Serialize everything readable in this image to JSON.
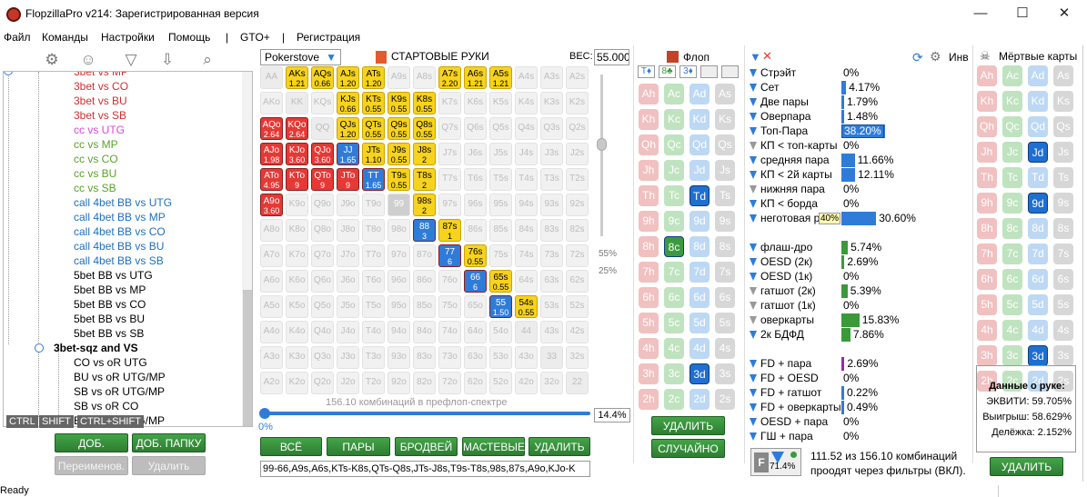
{
  "window": {
    "title": "FlopzillaPro v214: Зарегистрированная версия",
    "minimize": "—",
    "maximize": "☐",
    "close": "✕"
  },
  "menu": [
    "Файл",
    "Команды",
    "Настройки",
    "Помощь",
    "|",
    "GTO+",
    "|",
    "Регистрация"
  ],
  "tree": {
    "items": [
      {
        "text": "3bet vs MP",
        "color": "#d32f2f",
        "indent": 80
      },
      {
        "text": "3bet vs CO",
        "color": "#d32f2f",
        "indent": 80
      },
      {
        "text": "3bet vs BU",
        "color": "#d32f2f",
        "indent": 80
      },
      {
        "text": "3bet vs SB",
        "color": "#d32f2f",
        "indent": 80
      },
      {
        "text": "cc vs UTG",
        "color": "#d946d9",
        "indent": 80
      },
      {
        "text": "cc vs MP",
        "color": "#5aa22a",
        "indent": 80
      },
      {
        "text": "cc vs CO",
        "color": "#5aa22a",
        "indent": 80
      },
      {
        "text": "cc vs BU",
        "color": "#5aa22a",
        "indent": 80
      },
      {
        "text": "cc vs SB",
        "color": "#5aa22a",
        "indent": 80
      },
      {
        "text": "call 4bet BB vs UTG",
        "color": "#1e6fc0",
        "indent": 80
      },
      {
        "text": "call 4bet BB vs MP",
        "color": "#1e6fc0",
        "indent": 80
      },
      {
        "text": "call 4bet BB vs CO",
        "color": "#1e6fc0",
        "indent": 80
      },
      {
        "text": "call 4bet BB vs BU",
        "color": "#1e6fc0",
        "indent": 80
      },
      {
        "text": "call 4bet BB vs SB",
        "color": "#1e6fc0",
        "indent": 80
      },
      {
        "text": "5bet BB vs UTG",
        "color": "#000",
        "indent": 80
      },
      {
        "text": "5bet BB vs MP",
        "color": "#000",
        "indent": 80
      },
      {
        "text": "5bet BB vs CO",
        "color": "#000",
        "indent": 80
      },
      {
        "text": "5bet BB vs BU",
        "color": "#000",
        "indent": 80
      },
      {
        "text": "5bet BB vs SB",
        "color": "#000",
        "indent": 80
      },
      {
        "text": "3bet-sqz and VS",
        "color": "#000",
        "indent": 58,
        "bold": true
      },
      {
        "text": "CO vs oR UTG",
        "color": "#000",
        "indent": 80
      },
      {
        "text": "BU vs oR UTG/MP",
        "color": "#000",
        "indent": 80
      },
      {
        "text": "SB vs oR UTG/MP",
        "color": "#000",
        "indent": 80
      },
      {
        "text": "SB vs oR CO",
        "color": "#000",
        "indent": 80
      },
      {
        "text": "BB vs oR UTG/MP",
        "color": "#000",
        "indent": 80
      }
    ],
    "keys": [
      "CTRL",
      "SHIFT",
      "CTRL+SHIFT"
    ]
  },
  "left_buttons": {
    "add_range": "ДОБ. СПЕКТР",
    "add_folder": "ДОБ. ПАПКУ",
    "rename": "Переименов.",
    "delete": "Удалить"
  },
  "preflop": {
    "source": "Pokerstove",
    "title": "СТАРТОВЫЕ РУКИ",
    "weight_label": "ВЕС:",
    "weight": "55.000",
    "pct55": "55%",
    "pct25": "25%",
    "combos_text": "156.10 комбинаций в префлоп-спектре",
    "slider_pct": "0%",
    "pct_box": "14.4%",
    "range_text": "99-66,A9s,A6s,KTs-K8s,QTs-Q8s,JTs-J8s,T9s-T8s,98s,87s,A9o,KJo-K"
  },
  "grid_buttons": {
    "all": "ВСЁ",
    "pairs": "ПАРЫ",
    "broadway": "БРОДВЕЙ",
    "suited": "МАСТЕВЫЕ",
    "delete": "УДАЛИТЬ"
  },
  "grid_ranks": [
    "A",
    "K",
    "Q",
    "J",
    "T",
    "9",
    "8",
    "7",
    "6",
    "5",
    "4",
    "3",
    "2"
  ],
  "grid_selected": {
    "0,1": [
      "y",
      "1.21"
    ],
    "0,2": [
      "y",
      "0.66"
    ],
    "0,3": [
      "y",
      "1.20"
    ],
    "0,4": [
      "y",
      "1.20"
    ],
    "0,7": [
      "y",
      "2.20"
    ],
    "0,8": [
      "y",
      "1.21"
    ],
    "0,9": [
      "y",
      "1.21"
    ],
    "1,3": [
      "y",
      "0.66"
    ],
    "1,4": [
      "y",
      "0.55"
    ],
    "1,5": [
      "y",
      "0.55"
    ],
    "1,6": [
      "y",
      "0.55"
    ],
    "2,0": [
      "r",
      "2.64"
    ],
    "2,1": [
      "r",
      "2.64"
    ],
    "2,3": [
      "y",
      "1.20"
    ],
    "2,4": [
      "y",
      "0.55"
    ],
    "2,5": [
      "y",
      "0.55"
    ],
    "2,6": [
      "y",
      "0.55"
    ],
    "3,0": [
      "r",
      "1.98"
    ],
    "3,1": [
      "r",
      "3.60"
    ],
    "3,2": [
      "r",
      "3.60"
    ],
    "3,3": [
      "b",
      "1.65"
    ],
    "3,4": [
      "y",
      "1.10"
    ],
    "3,5": [
      "y",
      "0.55"
    ],
    "3,6": [
      "y",
      "2"
    ],
    "4,0": [
      "r",
      "4.95"
    ],
    "4,1": [
      "r",
      "9"
    ],
    "4,2": [
      "r",
      "9"
    ],
    "4,3": [
      "r",
      "9"
    ],
    "4,4": [
      "b",
      "1.65"
    ],
    "4,5": [
      "y",
      "0.55"
    ],
    "4,6": [
      "y",
      "2"
    ],
    "5,0": [
      "r",
      "3.60"
    ],
    "5,6": [
      "y",
      "2"
    ],
    "6,6": [
      "b",
      "3"
    ],
    "6,7": [
      "y",
      "1"
    ],
    "7,7": [
      "b",
      "6"
    ],
    "7,8": [
      "y",
      "0.55"
    ],
    "8,8": [
      "b",
      "6"
    ],
    "8,9": [
      "y",
      "0.55"
    ],
    "9,9": [
      "b",
      "1.50"
    ],
    "9,10": [
      "y",
      "0.55"
    ]
  },
  "flop": {
    "title": "Флоп",
    "slots": [
      "T♦",
      "8♣",
      "3♦",
      "",
      ""
    ],
    "delete": "УДАЛИТЬ",
    "random": "СЛУЧАЙНО"
  },
  "card_ranks": [
    "A",
    "K",
    "Q",
    "J",
    "T",
    "9",
    "8",
    "7",
    "6",
    "5",
    "4",
    "3",
    "2"
  ],
  "flop_selected": {
    "T,♦": "blue",
    "8,♣": "green",
    "3,♦": "blue"
  },
  "filters": [
    {
      "label": "Стрэйт",
      "value": "0%",
      "bar": 0,
      "icon": "b"
    },
    {
      "label": "Сет",
      "value": "4.17%",
      "bar": 4.17,
      "icon": "b"
    },
    {
      "label": "Две пары",
      "value": "1.79%",
      "bar": 1.79,
      "icon": "b"
    },
    {
      "label": "Оверпара",
      "value": "1.48%",
      "bar": 1.48,
      "icon": "b"
    },
    {
      "label": "Топ-Пара",
      "value": "38.20%",
      "bar": 38.2,
      "icon": "b",
      "boxed": true
    },
    {
      "label": "КП < топ-карты",
      "value": "0%",
      "bar": 0,
      "icon": "g"
    },
    {
      "label": "средняя пара",
      "value": "11.66%",
      "bar": 11.66,
      "icon": "b"
    },
    {
      "label": "КП < 2й карты",
      "value": "12.11%",
      "bar": 12.11,
      "icon": "b"
    },
    {
      "label": "нижняя пара",
      "value": "0%",
      "bar": 0,
      "icon": "g"
    },
    {
      "label": "КП < борда",
      "value": "0%",
      "bar": 0,
      "icon": "b"
    },
    {
      "label": "неготовая р",
      "value": "30.60%",
      "bar": 30.6,
      "icon": "b",
      "tag": "40%"
    },
    {
      "label": "",
      "value": "",
      "bar": 0,
      "icon": "none"
    },
    {
      "label": "флаш-дро",
      "value": "5.74%",
      "bar": 5.74,
      "icon": "b",
      "color": "g"
    },
    {
      "label": "OESD (2к)",
      "value": "2.69%",
      "bar": 2.69,
      "icon": "b",
      "color": "g"
    },
    {
      "label": "OESD (1к)",
      "value": "0%",
      "bar": 0,
      "icon": "b",
      "color": "g"
    },
    {
      "label": "гатшот (2к)",
      "value": "5.39%",
      "bar": 5.39,
      "icon": "g",
      "color": "g"
    },
    {
      "label": "гатшот (1к)",
      "value": "0%",
      "bar": 0,
      "icon": "g",
      "color": "g"
    },
    {
      "label": "оверкарты",
      "value": "15.83%",
      "bar": 15.83,
      "icon": "g",
      "color": "g"
    },
    {
      "label": "2к БДФД",
      "value": "7.86%",
      "bar": 7.86,
      "icon": "b",
      "color": "g"
    },
    {
      "label": "",
      "value": "",
      "bar": 0,
      "icon": "none"
    },
    {
      "label": "FD + пара",
      "value": "2.69%",
      "bar": 2.69,
      "icon": "b",
      "color": "p"
    },
    {
      "label": "FD + OESD",
      "value": "0%",
      "bar": 0,
      "icon": "b"
    },
    {
      "label": "FD + гатшот",
      "value": "0.22%",
      "bar": 0.22,
      "icon": "b"
    },
    {
      "label": "FD + оверкарты",
      "value": "0.49%",
      "bar": 0.49,
      "icon": "b"
    },
    {
      "label": "OESD + пара",
      "value": "0%",
      "bar": 0,
      "icon": "b"
    },
    {
      "label": "ГШ + пара",
      "value": "0%",
      "bar": 0,
      "icon": "b"
    }
  ],
  "filter_stats": {
    "badge": "71.4%",
    "text": "111.52 из 156.10 комбинаций проодят через фильтры (ВКЛ)."
  },
  "inv_label": "Инв",
  "dead": {
    "title": "Мёртвые карты",
    "selected": {
      "J,♦": "blue",
      "9,♦": "blue",
      "3,♦": "blue"
    },
    "delete": "УДАЛИТЬ"
  },
  "hand_info": {
    "title": "Данные о руке:",
    "equity": "ЭКВИТИ: 59.705%",
    "win": "Выигрыш: 58.629%",
    "tie": "Делёжка: 2.152%"
  },
  "status": "Ready",
  "colors": {
    "green": "#3b9a3f",
    "blue": "#2f7bd8",
    "red": "#e53935",
    "yellow": "#f7d21e"
  }
}
